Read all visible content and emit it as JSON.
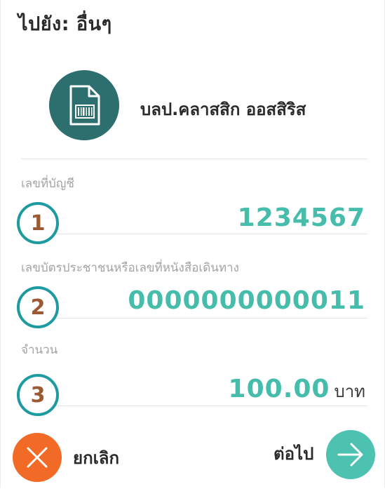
{
  "header": {
    "title": "ไปยัง: อื่นๆ"
  },
  "payee": {
    "icon": "document-barcode-icon",
    "name": "บลป.คลาสสิก ออสสิริส"
  },
  "fields": {
    "account": {
      "label": "เลขที่บัญชี",
      "value": "1234567",
      "step": "1"
    },
    "id_number": {
      "label": "เลขบัตรประชาชนหรือเลขที่หนังสือเดินทาง",
      "value": "0000000000011",
      "step": "2"
    },
    "amount": {
      "label": "จำนวน",
      "value": "100.00",
      "unit": "บาท",
      "step": "3"
    }
  },
  "actions": {
    "cancel_label": "ยกเลิก",
    "next_label": "ต่อไป",
    "cancel_icon": "close-icon",
    "next_icon": "arrow-right-icon"
  },
  "colors": {
    "accent": "#46bcaa",
    "icon_bg": "#2c6f6e",
    "cancel": "#f26b26",
    "next": "#4dc2b1",
    "badge_ring": "#1e9ba0",
    "badge_number": "#9b5a34"
  }
}
